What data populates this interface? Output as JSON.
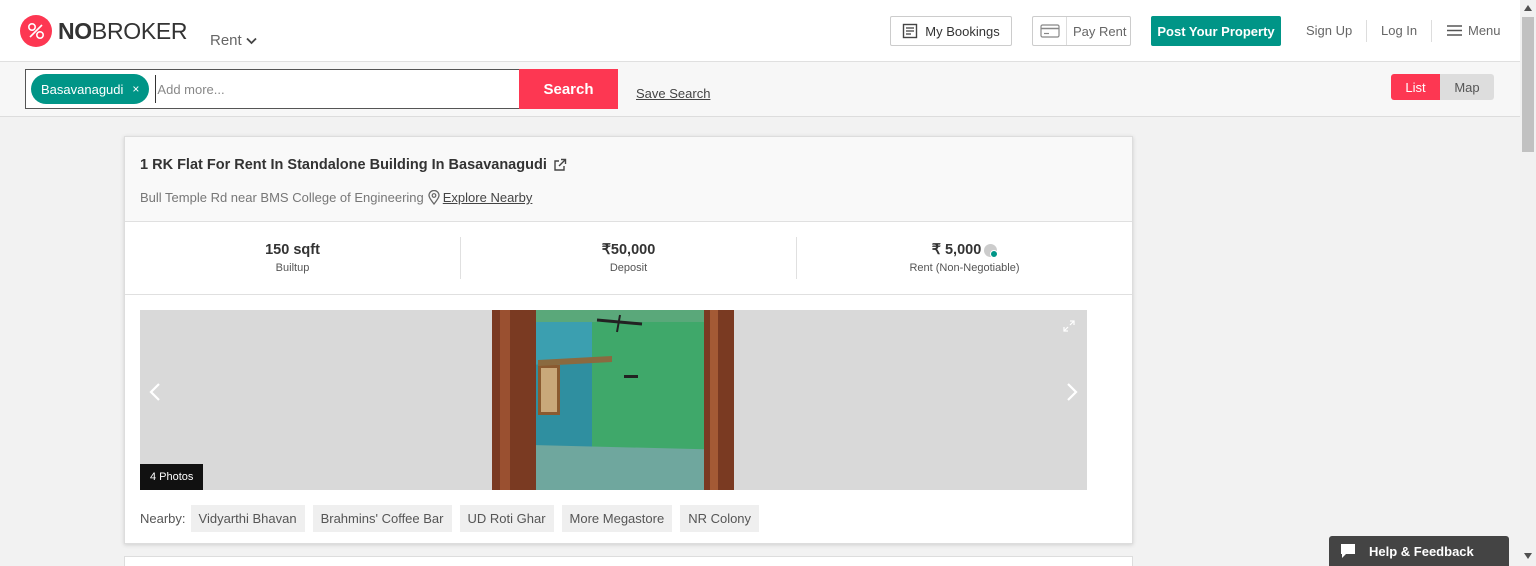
{
  "header": {
    "logo_bold": "NO",
    "logo_regular": "BROKER",
    "rent_dropdown": "Rent",
    "my_bookings": "My Bookings",
    "pay_rent": "Pay Rent",
    "post_property": "Post Your Property",
    "sign_up": "Sign Up",
    "log_in": "Log In",
    "menu": "Menu",
    "brand_color": "#fd3752",
    "accent_color": "#009587"
  },
  "search": {
    "chip": "Basavanagudi",
    "chip_close": "×",
    "placeholder": "Add more...",
    "search_button": "Search",
    "save_search": "Save Search",
    "view_list": "List",
    "view_map": "Map"
  },
  "listing": {
    "title": "1 RK Flat For Rent In Standalone Building In Basavanagudi",
    "address": "Bull Temple Rd near BMS College of Engineering",
    "explore": "Explore Nearby",
    "stats": [
      {
        "value": "150 sqft",
        "label": "Builtup"
      },
      {
        "value": "₹50,000",
        "label": "Deposit"
      },
      {
        "value": "₹ 5,000",
        "label": "Rent (Non-Negotiable)"
      }
    ],
    "photos_count": "4 Photos",
    "nearby_label": "Nearby:",
    "nearby": [
      "Vidyarthi Bhavan",
      "Brahmins' Coffee Bar",
      "UD Roti Ghar",
      "More Megastore",
      "NR Colony"
    ]
  },
  "help": {
    "label": "Help & Feedback"
  }
}
